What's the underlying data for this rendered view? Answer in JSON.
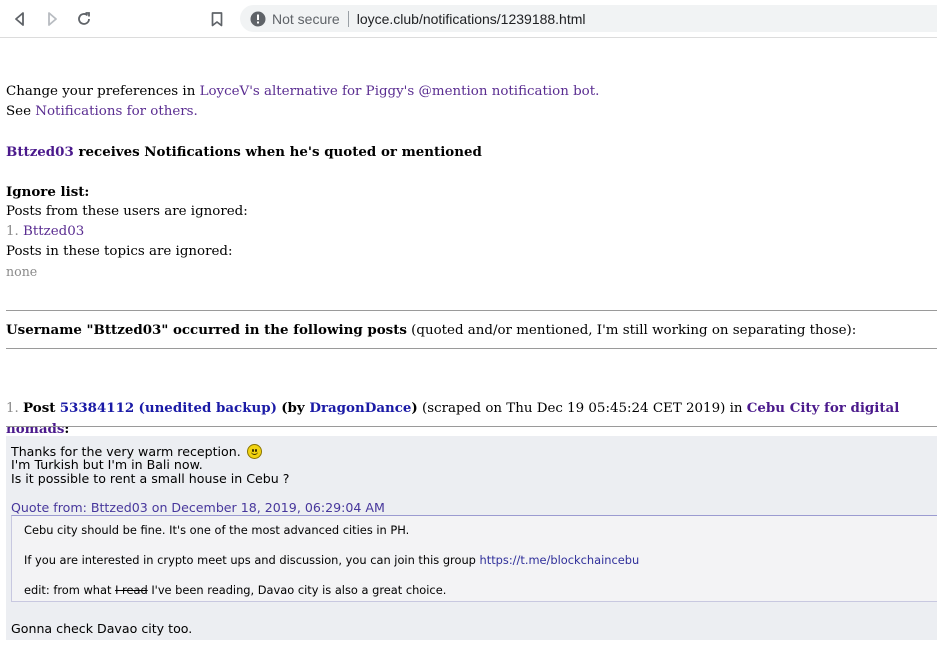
{
  "browser": {
    "security_label": "Not secure",
    "url": "loyce.club/notifications/1239188.html"
  },
  "prefs": {
    "prefix": "Change your preferences in ",
    "link": "LoyceV's alternative for Piggy's @mention notification bot.",
    "see_prefix": "See ",
    "see_link": "Notifications for others."
  },
  "heading": {
    "user": "Bttzed03",
    "rest": " receives Notifications when he's quoted or mentioned"
  },
  "ignore": {
    "title": "Ignore list:",
    "users_label": "Posts from these users are ignored:",
    "users": [
      {
        "num": "1.",
        "name": "Bttzed03"
      }
    ],
    "topics_label": "Posts in these topics are ignored:",
    "topics_value": "none"
  },
  "occurrence": {
    "bold": "Username \"Bttzed03\" occurred in the following posts",
    "note": " (quoted and/or mentioned, I'm still working on separating those):"
  },
  "post": {
    "num": "1.",
    "label": "Post",
    "id": "53384112",
    "backup": "(unedited backup)",
    "by_open": "(by ",
    "author": "DragonDance",
    "by_close": ")",
    "scraped": " (scraped on Thu Dec 19 05:45:24 CET 2019) in ",
    "topic": "Cebu City for digital nomads",
    "colon": ":",
    "line1": "Thanks for the very warm reception.",
    "line2": "I'm Turkish but I'm in Bali now.",
    "line3": "Is it possible to rent a small house in Cebu ?",
    "quote_header": "Quote from: Bttzed03 on December 18, 2019, 06:29:04 AM",
    "quote_line1": "Cebu city should be fine. It's one of the most advanced cities in PH.",
    "quote_line2_prefix": "If you are interested in crypto meet ups and discussion, you can join this group ",
    "quote_line2_link": "https://t.me/blockchaincebu",
    "quote_line3_prefix": "edit: from what ",
    "quote_line3_strike": "I read",
    "quote_line3_rest": " I've been reading, Davao city is also a great choice.",
    "closing": "Gonna check Davao city too."
  }
}
